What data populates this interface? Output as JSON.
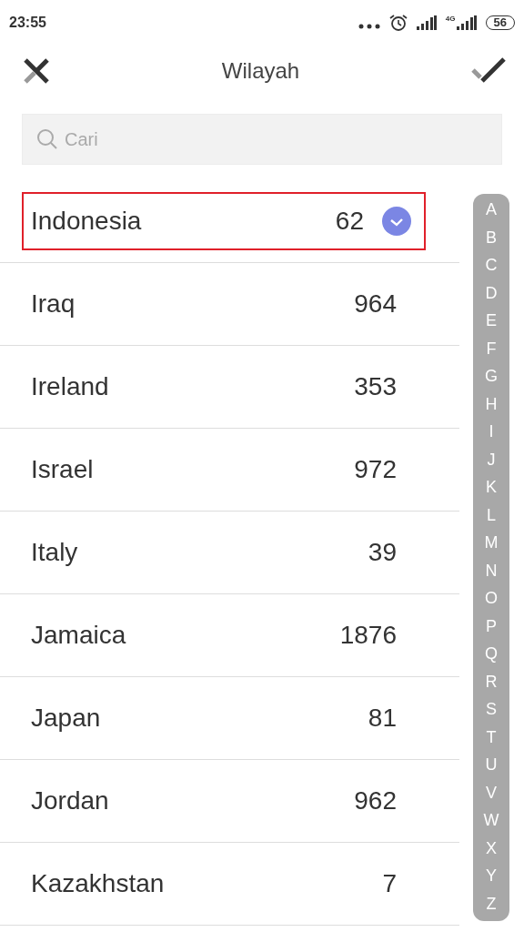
{
  "status_bar": {
    "time": "23:55",
    "network": "4G",
    "battery": "56"
  },
  "header": {
    "title": "Wilayah"
  },
  "search": {
    "placeholder": "Cari"
  },
  "countries": [
    {
      "name": "Indonesia",
      "code": "62",
      "selected": true
    },
    {
      "name": "Iraq",
      "code": "964",
      "selected": false
    },
    {
      "name": "Ireland",
      "code": "353",
      "selected": false
    },
    {
      "name": "Israel",
      "code": "972",
      "selected": false
    },
    {
      "name": "Italy",
      "code": "39",
      "selected": false
    },
    {
      "name": "Jamaica",
      "code": "1876",
      "selected": false
    },
    {
      "name": "Japan",
      "code": "81",
      "selected": false
    },
    {
      "name": "Jordan",
      "code": "962",
      "selected": false
    },
    {
      "name": "Kazakhstan",
      "code": "7",
      "selected": false
    }
  ],
  "index_letters": [
    "A",
    "B",
    "C",
    "D",
    "E",
    "F",
    "G",
    "H",
    "I",
    "J",
    "K",
    "L",
    "M",
    "N",
    "O",
    "P",
    "Q",
    "R",
    "S",
    "T",
    "U",
    "V",
    "W",
    "X",
    "Y",
    "Z"
  ]
}
